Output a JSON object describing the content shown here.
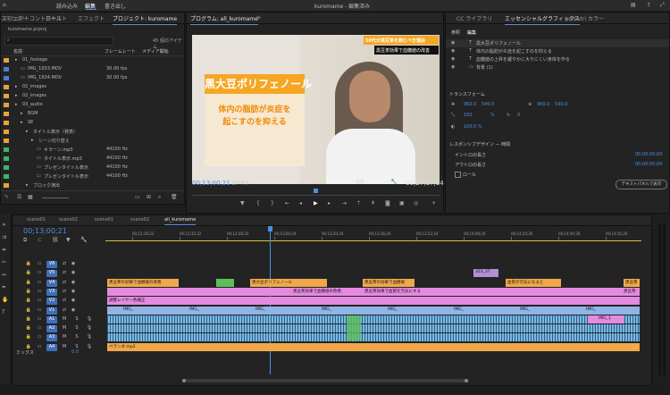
{
  "app": {
    "title": "kuromame - 編集済み",
    "nav_tabs": [
      "読み込み",
      "編集",
      "書き出し"
    ]
  },
  "project_panel": {
    "tabs": [
      "ソースモニター",
      "エフェクトコントロール",
      "テキスト",
      "エフェクト",
      "プロジェクト: kuromame"
    ],
    "project_file": "kuromame.prproj",
    "item_count": "45 個のアイテム",
    "columns": [
      "名前",
      "フレームレート",
      "メディア開始"
    ],
    "rows": [
      {
        "name": "01_footage",
        "fps": "",
        "color": "#e7a33b",
        "indent": 1
      },
      {
        "name": "IMG_1933.MOV",
        "fps": "30.00 fps",
        "color": "#4a7cd6",
        "indent": 2
      },
      {
        "name": "IMG_1934.MOV",
        "fps": "30.00 fps",
        "color": "#4a7cd6",
        "indent": 2
      },
      {
        "name": "02_images",
        "fps": "",
        "color": "#e7a33b",
        "indent": 1
      },
      {
        "name": "02_images",
        "fps": "",
        "color": "#e7a33b",
        "indent": 1
      },
      {
        "name": "03_audio",
        "fps": "",
        "color": "#e7a33b",
        "indent": 1
      },
      {
        "name": "BGM",
        "fps": "",
        "color": "#e7a33b",
        "indent": 2
      },
      {
        "name": "SE",
        "fps": "",
        "color": "#e7a33b",
        "indent": 2
      },
      {
        "name": "タイトル表示（発表）",
        "fps": "",
        "color": "#e7a33b",
        "indent": 3
      },
      {
        "name": "シーン切り替え",
        "fps": "",
        "color": "#e7a33b",
        "indent": 4
      },
      {
        "name": "キラーン.mp3",
        "fps": "44100 Hz",
        "color": "#3cb46a",
        "indent": 5
      },
      {
        "name": "タイトル表示.mp3",
        "fps": "44100 Hz",
        "color": "#3cb46a",
        "indent": 5
      },
      {
        "name": "プレゼンタイトル表示",
        "fps": "44100 Hz",
        "color": "#3cb46a",
        "indent": 5
      },
      {
        "name": "プレゼンタイトル表示",
        "fps": "44100 Hz",
        "color": "#3cb46a",
        "indent": 5
      },
      {
        "name": "ブロック演出",
        "fps": "",
        "color": "#e7a33b",
        "indent": 3
      }
    ]
  },
  "program_monitor": {
    "tab": "プログラム: all_kuromame",
    "title_card": "黒大豆ポリフェノール",
    "subtitle_line1": "体内の脂肪が炎症を",
    "subtitle_line2": "起こすのを抑える",
    "corner_tag": "50代が黒豆茶を飲むべき理由",
    "corner_sub": "黒豆茶効果で血糖値の改善",
    "timecode": "00;13;00;21",
    "fit": "全体表示",
    "quality": "1/2",
    "duration": "00;27;17;14"
  },
  "essential_graphics": {
    "tabs": [
      "CC ライブラリ",
      "エッセンシャルグラフィックス",
      "Lumetri カラー"
    ],
    "subtabs": [
      "参照",
      "編集"
    ],
    "layers": [
      "黒大豆ポリフェノール",
      "体内の脂肪が炎症を起こすのを抑える",
      "血糖値の上昇を緩やかに大りにくい身体を作る",
      "背景 (1)"
    ],
    "transform_label": "トランスフォーム",
    "pos_x": "960.0",
    "pos_y": "540.0",
    "anchor_x": "960.0",
    "anchor_y": "540.0",
    "scale": "100",
    "scale_pct": "%",
    "rotation": "0",
    "opacity": "100.0 %",
    "responsive_label": "レスポンシブデザイン — 時間",
    "intro_label": "イントロの長さ",
    "intro_value": "00;00;00;00",
    "outro_label": "アウトロの長さ",
    "outro_value": "00;00;00;00",
    "roll_label": "ロール",
    "text_panel_button": "テキストパネルで表示"
  },
  "timeline": {
    "tabs": [
      "scene01",
      "scene02",
      "scene01",
      "scene02",
      "all_kuromame"
    ],
    "timecode": "00;13;00;21",
    "ruler": [
      "00;12;16;22",
      "00;12;32;22",
      "00;12;48;22",
      "00;13;04;24",
      "00;13;20;24",
      "00;13;36;24",
      "00;13;52;24",
      "00;14;08;24",
      "00;14;24;26",
      "00;14;40;26",
      "00;14;56;26"
    ],
    "tracks": [
      "V6",
      "V5",
      "V4",
      "V3",
      "V2",
      "V1",
      "A1",
      "A2",
      "A3",
      "A4"
    ],
    "mix_label": "ミックス",
    "mix_value": "0.0",
    "clips": {
      "v5_a": "323_37",
      "v4_a": "黒豆茶の効果で血糖値の改善",
      "v4_b": "黒大豆ポリフェノール",
      "v4_c": "黒豆茶の効果で血糖値",
      "v4_d": "血管が元気になると",
      "v4_e": "黒豆茶",
      "v3_a": "黒豆茶効果で血糖値の改善",
      "v3_b": "黒豆茶効果で血管を元気にする",
      "v3_c": "黒豆茶",
      "v2_a": "調整レイヤー色補正",
      "v1_img": "IMG_",
      "v1_img2": "IMG_1",
      "a4_bgm": "ベランダ.mp3"
    }
  }
}
